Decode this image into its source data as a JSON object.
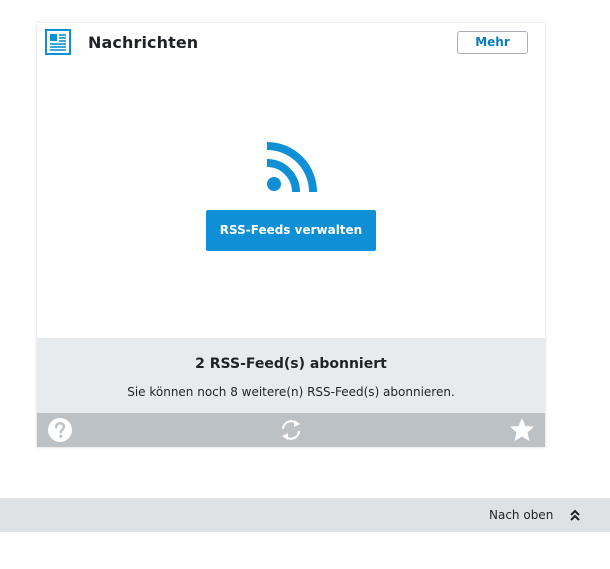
{
  "widget": {
    "title": "Nachrichten",
    "icon": "newspaper-icon",
    "more_label": "Mehr",
    "rss_icon": "rss-icon",
    "manage_label": "RSS-Feeds verwalten",
    "info": {
      "title": "2 RSS-Feed(s) abonniert",
      "text": "Sie können noch 8 weitere(n) RSS-Feed(s) abonnieren."
    },
    "footer": {
      "help_icon": "help-icon",
      "refresh_icon": "refresh-icon",
      "favorite_icon": "star-icon"
    }
  },
  "page_footer": {
    "back_to_top_label": "Nach oben",
    "back_to_top_icon": "double-chevron-up-icon"
  },
  "colors": {
    "accent": "#0f8fd6",
    "link": "#0a7cbd",
    "info_background": "#e8ebee",
    "footer_background": "#bcc1c6",
    "page_bar_background": "#dfe2e5"
  }
}
